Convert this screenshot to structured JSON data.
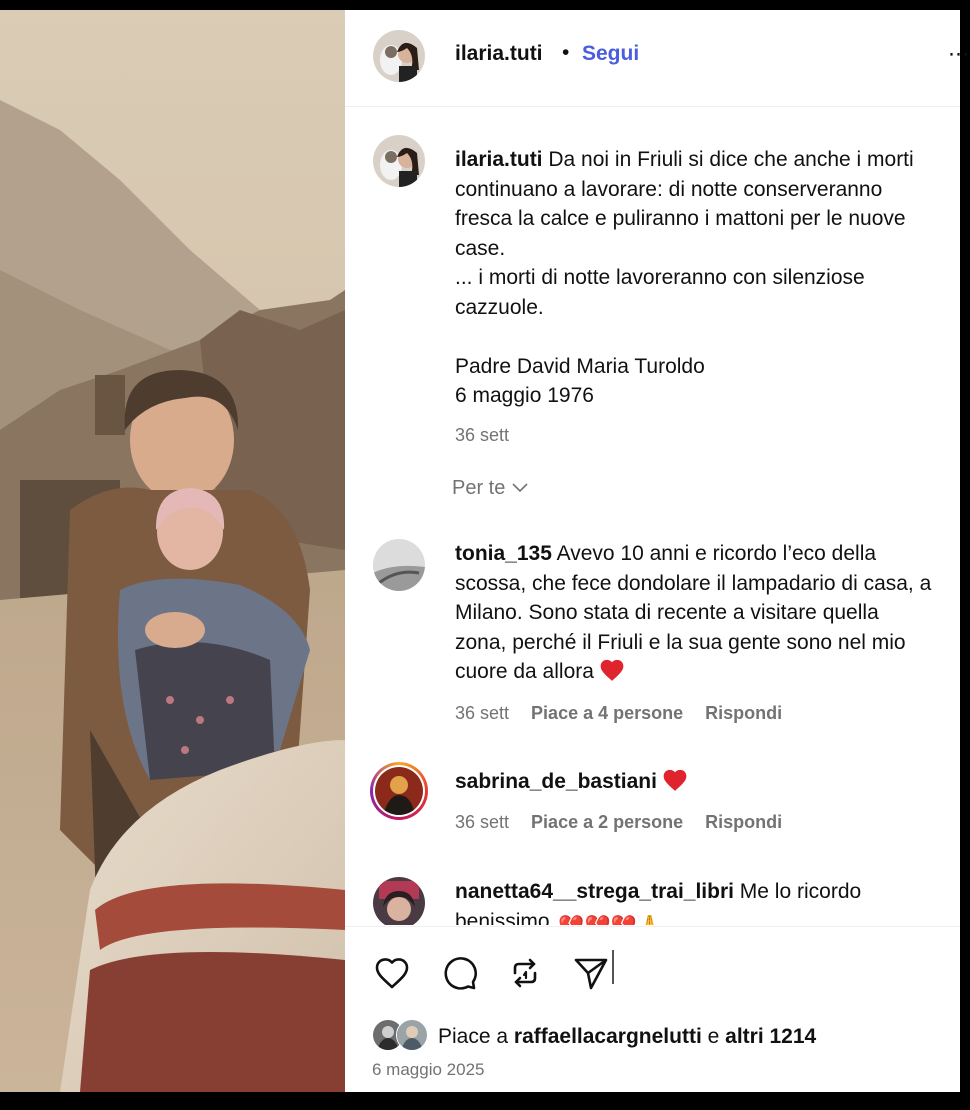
{
  "post": {
    "author": "ilaria.tuti",
    "separator": "•",
    "follow_label": "Segui",
    "more_label": "⋯",
    "photo_alt": "Vintage photo of a man holding a baby among earthquake ruins"
  },
  "caption": {
    "username": "ilaria.tuti",
    "text": " Da noi in Friuli si dice che anche i morti continuano a lavorare: di notte conserveranno fresca la calce e puliranno i mattoni per le nuove case.\n... i morti di notte lavoreranno con silenziose cazzuole.\n\nPadre David Maria Turoldo\n6 maggio 1976",
    "time": "36 sett"
  },
  "sort_label": "Per te",
  "comments": [
    {
      "username": "tonia_135",
      "text": " Avevo 10 anni e ricordo l’eco della scossa, che fece dondolare il lampadario di casa, a Milano. Sono stata di recente a visitare quella zona, perché il Friuli e la sua gente sono nel mio cuore da allora",
      "emoji": "red-heart",
      "time": "36 sett",
      "likes": "Piace a 4 persone",
      "reply": "Rispondi"
    },
    {
      "username": "sabrina_de_bastiani",
      "text": "",
      "emoji": "red-heart",
      "time": "36 sett",
      "likes": "Piace a 2 persone",
      "reply": "Rispondi"
    },
    {
      "username": "nanetta64__strega_trai_libri",
      "text": " Me lo ricordo benissimo",
      "emoji": "💔💔💔🙏"
    }
  ],
  "actions": {
    "icons": [
      "heart-icon",
      "comment-icon",
      "repost-icon",
      "share-icon"
    ]
  },
  "likes": {
    "prefix": "Piace a ",
    "user": "raffaellacargnelutti",
    "middle": " e ",
    "others": "altri 1214"
  },
  "date": "6 maggio 2025",
  "colors": {
    "accent": "#4a5de0",
    "heart": "#e0242e",
    "muted": "#737373"
  }
}
